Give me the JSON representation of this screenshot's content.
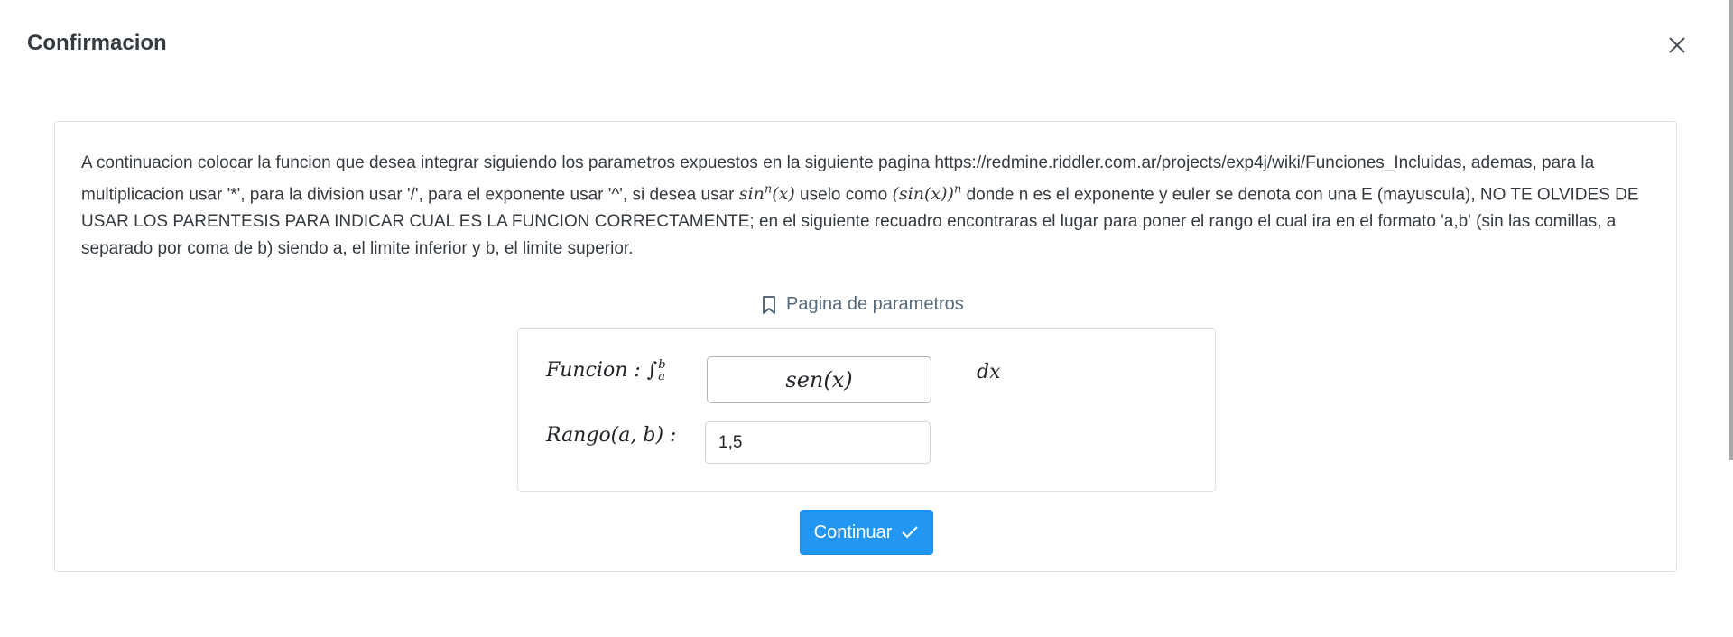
{
  "modal": {
    "title": "Confirmacion"
  },
  "description": {
    "part1": "A continuacion colocar la funcion que desea integrar siguiendo los parametros expuestos en la siguiente pagina https://redmine.riddler.com.ar/projects/exp4j/wiki/Funciones_Incluidas, ademas, para la multiplicacion usar '*', para la division usar '/', para el exponente usar '^', si desea usar ",
    "math1_base": "sin",
    "math1_sup": "n",
    "math1_arg": "(x)",
    "part2": " uselo como ",
    "math2_base": "(sin(x))",
    "math2_sup": "n",
    "part3": " donde n es el exponente y euler se denota con una E (mayuscula), NO TE OLVIDES DE USAR LOS PARENTESIS PARA INDICAR CUAL ES LA FUNCION CORRECTAMENTE; en el siguiente recuadro encontraras el lugar para poner el rango el cual ira en el formato 'a,b' (sin las comillas, a separado por coma de b) siendo a, el limite inferior y b, el limite superior."
  },
  "params_link": {
    "label": "Pagina de parametros",
    "icon": "bookmark-icon"
  },
  "form": {
    "funcion_label": "Funcion : ",
    "integral_symbol": "∫",
    "upper_limit": "b",
    "lower_limit": "a",
    "funcion_value": "sen(x)",
    "dx_label": "dx",
    "rango_label": "Rango(a, b) :",
    "rango_value": "1,5"
  },
  "actions": {
    "continue_label": "Continuar",
    "continue_icon": "check-icon"
  },
  "colors": {
    "primary": "#2196f3",
    "link": "#55697a",
    "border": "#dee2e6"
  }
}
